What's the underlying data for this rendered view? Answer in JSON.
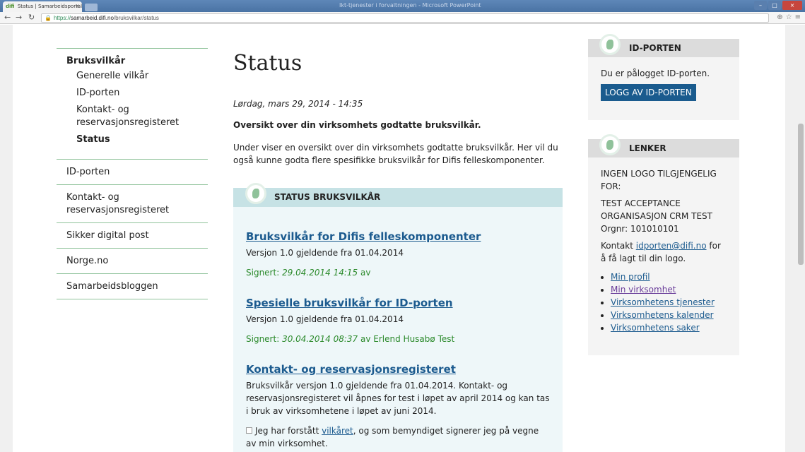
{
  "browser": {
    "tab_title": "Status | Samarbeidsportale",
    "tab_favicon": "difi",
    "window_title": "Ikt-tjenester i forvaltningen - Microsoft PowerPoint",
    "url_https": "https://",
    "url_host": "samarbeid.difi.no",
    "url_path": "/bruksvilkar/status"
  },
  "leftnav": {
    "group_title": "Bruksvilkår",
    "subitems": [
      "Generelle vilkår",
      "ID-porten",
      "Kontakt- og reservasjonsregisteret",
      "Status"
    ],
    "items": [
      "ID-porten",
      "Kontakt- og reservasjonsregisteret",
      "Sikker digital post",
      "Norge.no",
      "Samarbeidsbloggen"
    ]
  },
  "main": {
    "title": "Status",
    "date": "Lørdag, mars 29, 2014 - 14:35",
    "lead": "Oversikt over din virksomhets godtatte bruksvilkår.",
    "intro": "Under viser en oversikt over din virksomhets godtatte bruksvilkår. Her vil du også kunne godta flere spesifikke bruksvilkår for Difis felleskomponenter."
  },
  "status": {
    "heading": "STATUS BRUKSVILKÅR",
    "entries": [
      {
        "title": "Bruksvilkår for Difis felleskomponenter",
        "version": "Versjon 1.0 gjeldende fra 01.04.2014",
        "signed_label": "Signert:",
        "signed_date": "29.04.2014 14:15",
        "signed_by": "av"
      },
      {
        "title": "Spesielle bruksvilkår for ID-porten",
        "version": "Versjon 1.0 gjeldende fra 01.04.2014",
        "signed_label": "Signert:",
        "signed_date": "30.04.2014 08:37",
        "signed_by": "av Erlend Husabø Test"
      },
      {
        "title": "Kontakt- og reservasjonsregisteret",
        "version": "Bruksvilkår versjon 1.0 gjeldende fra 01.04.2014. Kontakt- og reservasjonsregisteret vil åpnes for test i løpet av april 2014 og kan tas i bruk av virksomhetene i løpet av juni 2014."
      }
    ],
    "checkbox_pre": "Jeg har forstått ",
    "checkbox_link": "vilkåret",
    "checkbox_post": ", og som bemyndiget signerer jeg på vegne av min virksomhet."
  },
  "idporten": {
    "heading": "ID-PORTEN",
    "text": "Du er pålogget ID-porten.",
    "button": "LOGG AV ID-PORTEN"
  },
  "lenker": {
    "heading": "LENKER",
    "nologo": "INGEN LOGO TILGJENGELIG FOR:",
    "org": "TEST ACCEPTANCE ORGANISASJON CRM TEST",
    "orgnr": "Orgnr: 101010101",
    "contact_pre": "Kontakt ",
    "contact_link": "idporten@difi.no",
    "contact_post": " for å få lagt til din logo.",
    "links": [
      "Min profil",
      "Min virksomhet",
      "Virksomhetens tjenester",
      "Virksomhetens kalender",
      "Virksomhetens saker"
    ]
  }
}
